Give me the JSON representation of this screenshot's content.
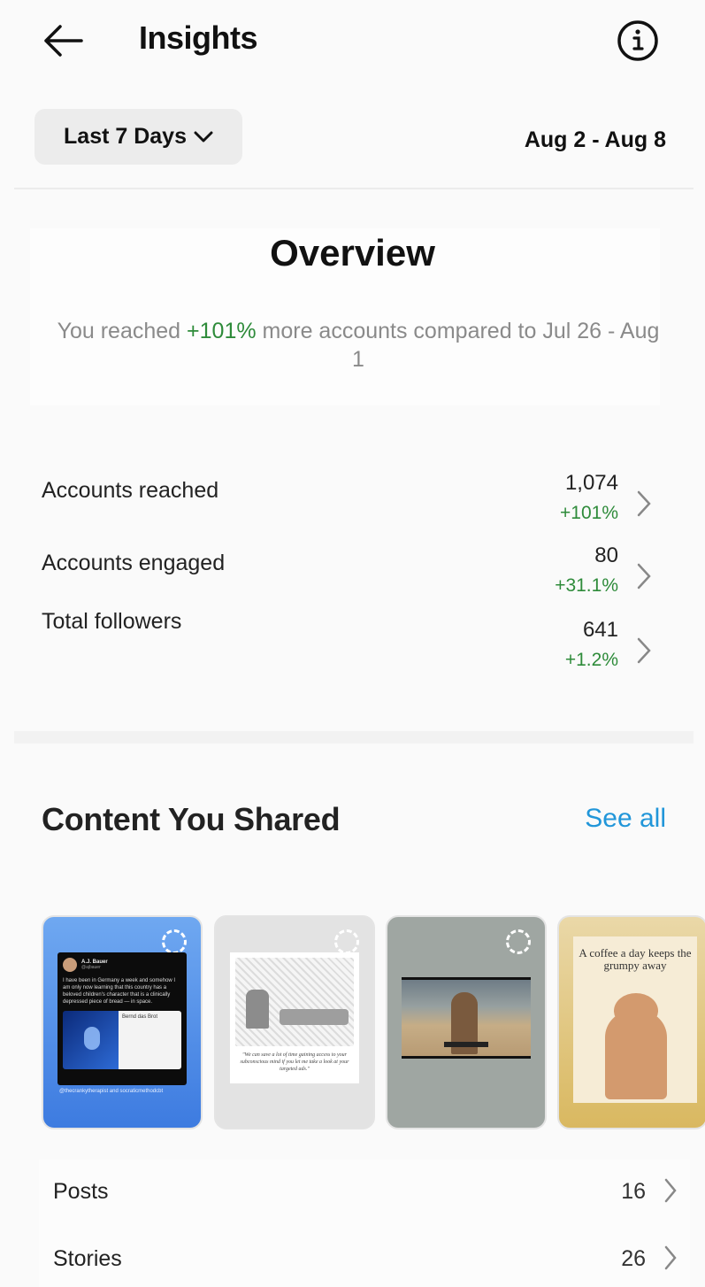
{
  "header": {
    "title": "Insights",
    "back_icon": "arrow-left-icon",
    "info_icon": "info-circle-icon"
  },
  "filter": {
    "range_label": "Last 7 Days",
    "range_icon": "chevron-down-icon",
    "date_range": "Aug 2 - Aug 8"
  },
  "overview": {
    "title": "Overview",
    "summary_prefix": "You reached ",
    "summary_highlight": "+101%",
    "summary_suffix": " more accounts compared to  Jul 26 -  Aug 1",
    "highlight_color": "#2e8b3a"
  },
  "metrics": [
    {
      "label": "Accounts reached",
      "value": "1,074",
      "change": "+101%"
    },
    {
      "label": "Accounts engaged",
      "value": "80",
      "change": "+31.1%"
    },
    {
      "label": "Total followers",
      "value": "641",
      "change": "+1.2%"
    }
  ],
  "content": {
    "title": "Content You Shared",
    "see_all_label": "See all",
    "accent_color": "#2196d9",
    "thumbnails": [
      {
        "type": "story",
        "tweet_author": "A.J. Bauer",
        "tweet_handle": "@ajbauer",
        "tweet_text": "I have been in Germany a week and somehow I am only now learning that this country has a beloved children's character that is a clinically depressed piece of bread — in space.",
        "embedded_title": "Bernd das Brot",
        "caption": "@thecrankytherapist and socraticmethodcbt"
      },
      {
        "type": "story",
        "quote": "\"We can save a lot of time gaining access to your subconscious mind if you let me take a look at your targeted ads.\""
      },
      {
        "type": "story",
        "description": "video still"
      },
      {
        "type": "story",
        "quote": "A coffee a day keeps the grumpy away"
      }
    ]
  },
  "list": [
    {
      "label": "Posts",
      "value": "16"
    },
    {
      "label": "Stories",
      "value": "26"
    }
  ]
}
